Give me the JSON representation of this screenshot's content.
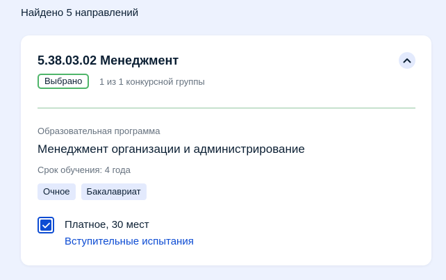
{
  "results": {
    "count_text": "Найдено 5 направлений"
  },
  "direction": {
    "title": "5.38.03.02 Менеджмент",
    "collapse_icon": "chevron-up-icon",
    "selected_badge": "Выбрано",
    "group_info": "1 из 1 конкурсной группы",
    "program_caption": "Образовательная программа",
    "program_name": "Менеджмент организации и администрирование",
    "duration": "Срок обучения: 4 года",
    "tags": [
      "Очное",
      "Бакалавриат"
    ],
    "option": {
      "checked": true,
      "label": "Платное, 30 мест",
      "link": "Вступительные испытания"
    }
  },
  "colors": {
    "page_background": "#edf2fe",
    "card_background": "#ffffff",
    "accent_blue": "#0d4cd3",
    "badge_green": "#4fb56a",
    "divider_green": "#93c7a1",
    "tag_background": "#e3eafd",
    "secondary_text": "#66727f",
    "primary_text": "#0b1f33"
  }
}
